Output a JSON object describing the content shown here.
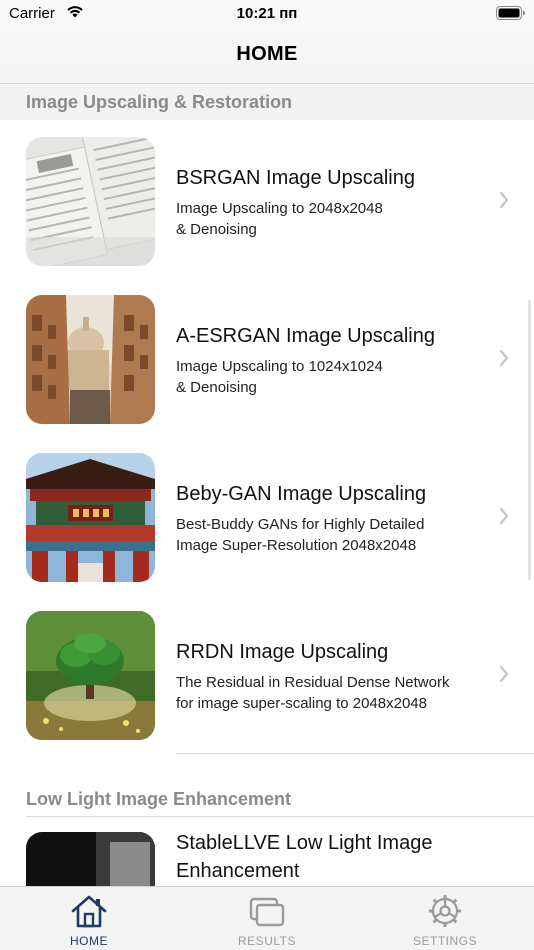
{
  "status_bar": {
    "carrier": "Carrier",
    "time": "10:21 пп"
  },
  "nav": {
    "title": "HOME"
  },
  "sections": [
    {
      "header": "Image Upscaling & Restoration"
    },
    {
      "header": "Low Light Image Enhancement"
    }
  ],
  "rows": [
    {
      "title": "BSRGAN Image Upscaling",
      "subtitle": "Image Upscaling to 2048x2048\n& Denoising",
      "thumb_icon": "newspaper-thumbnail"
    },
    {
      "title": "A-ESRGAN Image Upscaling",
      "subtitle": "Image Upscaling to 1024x1024\n& Denoising",
      "thumb_icon": "street-dome-thumbnail"
    },
    {
      "title": "Beby-GAN Image Upscaling",
      "subtitle": "Best-Buddy GANs for Highly Detailed\nImage Super-Resolution 2048x2048",
      "thumb_icon": "chinese-gate-thumbnail"
    },
    {
      "title": "RRDN Image Upscaling",
      "subtitle": "The Residual in Residual Dense Network\nfor image super-scaling to 2048x2048",
      "thumb_icon": "tree-glass-thumbnail"
    },
    {
      "title": "StableLLVE Low Light Image Enhancement",
      "subtitle": "",
      "thumb_icon": "dark-window-thumbnail"
    }
  ],
  "tabs": [
    {
      "label": "HOME",
      "icon": "house-icon",
      "active": true
    },
    {
      "label": "RESULTS",
      "icon": "stacked-windows-icon",
      "active": false
    },
    {
      "label": "SETTINGS",
      "icon": "gear-icon",
      "active": false
    }
  ],
  "colors": {
    "accent": "#1f3a66",
    "section_header_text": "#8a8a8a",
    "inactive_tab": "#9a9a9a"
  }
}
